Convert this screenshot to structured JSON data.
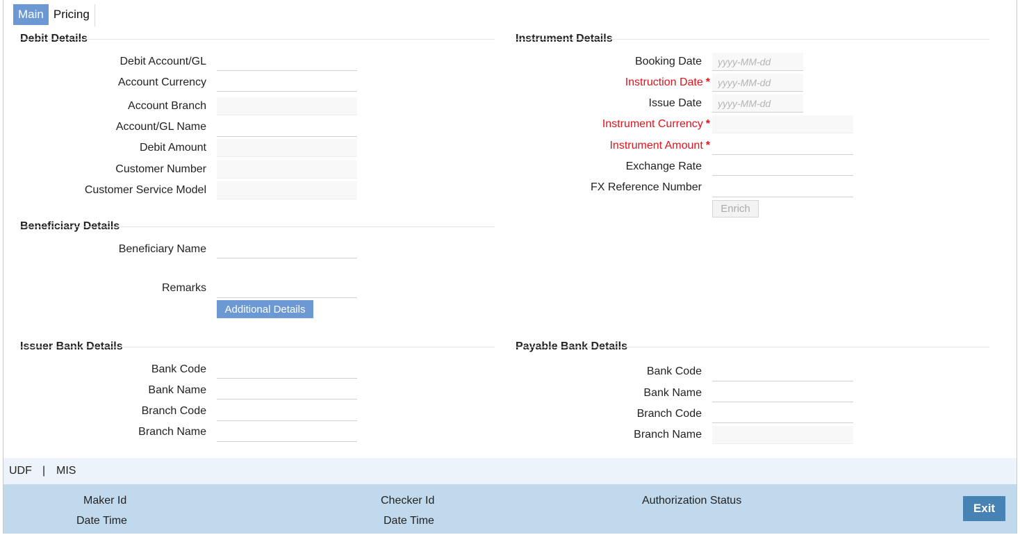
{
  "tabs": [
    {
      "label": "Main",
      "active": true
    },
    {
      "label": "Pricing",
      "active": false
    }
  ],
  "debit_details": {
    "title": "Debit Details",
    "debit_account_label": "Debit Account/GL",
    "account_currency_label": "Account Currency",
    "account_branch_label": "Account Branch",
    "account_name_label": "Account/GL Name",
    "debit_amount_label": "Debit Amount",
    "customer_number_label": "Customer Number",
    "customer_service_model_label": "Customer Service Model"
  },
  "instrument_details": {
    "title": "Instrument Details",
    "booking_date_label": "Booking Date",
    "instruction_date_label": "Instruction Date",
    "issue_date_label": "Issue Date",
    "instrument_currency_label": "Instrument Currency",
    "instrument_amount_label": "Instrument Amount",
    "exchange_rate_label": "Exchange Rate",
    "fx_reference_label": "FX Reference Number",
    "date_placeholder": "yyyy-MM-dd",
    "required_marker": "*",
    "enrich_label": "Enrich"
  },
  "beneficiary_details": {
    "title": "Beneficiary Details",
    "name_label": "Beneficiary Name",
    "remarks_label": "Remarks",
    "additional_details_label": "Additional Details"
  },
  "issuer_bank_details": {
    "title": "Issuer Bank Details",
    "bank_code_label": "Bank Code",
    "bank_name_label": "Bank Name",
    "branch_code_label": "Branch Code",
    "branch_name_label": "Branch Name"
  },
  "payable_bank_details": {
    "title": "Payable Bank Details",
    "bank_code_label": "Bank Code",
    "bank_name_label": "Bank Name",
    "branch_code_label": "Branch Code",
    "branch_name_label": "Branch Name"
  },
  "links": {
    "udf": "UDF",
    "separator": "|",
    "mis": "MIS"
  },
  "footer": {
    "maker_id": "Maker Id",
    "maker_date_time": "Date Time",
    "checker_id": "Checker Id",
    "checker_date_time": "Date Time",
    "authorization_status": "Authorization Status",
    "exit_label": "Exit"
  },
  "colors": {
    "accent": "#6c99d4",
    "required": "#e3121b",
    "footer_bg": "#c0d9ed",
    "exit_button": "#4682b4"
  }
}
